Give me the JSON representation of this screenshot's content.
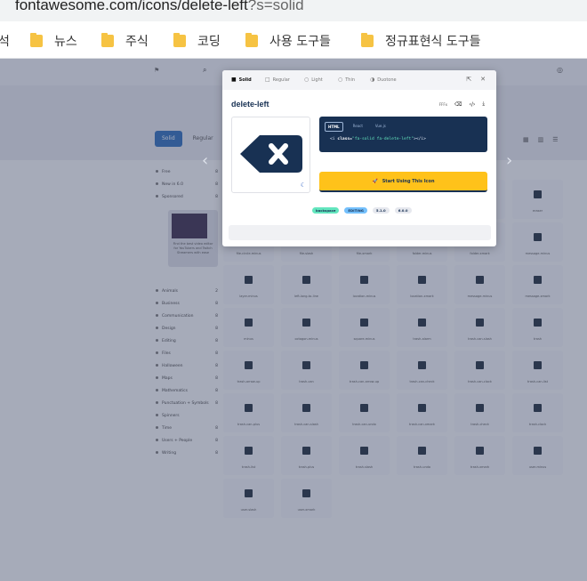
{
  "browser": {
    "url_host_path": "fontawesome.com/icons/delete-left",
    "url_query": "?s=solid"
  },
  "bookmarks": [
    {
      "label": "석",
      "folder": false
    },
    {
      "label": "뉴스",
      "folder": true
    },
    {
      "label": "주식",
      "folder": true
    },
    {
      "label": "코딩",
      "folder": true
    },
    {
      "label": "사용 도구들",
      "folder": true
    },
    {
      "label": "정규표현식 도구들",
      "folder": true
    }
  ],
  "page": {
    "tabs": [
      "Solid",
      "Regular"
    ],
    "sidebar_items": [
      {
        "label": "Free",
        "count": "8"
      },
      {
        "label": "New in 6.0",
        "count": "8"
      },
      {
        "label": "Sponsored",
        "count": "8"
      },
      {
        "label": "Animals",
        "count": "2"
      },
      {
        "label": "Business",
        "count": "8"
      },
      {
        "label": "Communication",
        "count": "8"
      },
      {
        "label": "Design",
        "count": "8"
      },
      {
        "label": "Editing",
        "count": "8"
      },
      {
        "label": "Files",
        "count": "8"
      },
      {
        "label": "Halloween",
        "count": "8"
      },
      {
        "label": "Maps",
        "count": "8"
      },
      {
        "label": "Mathematics",
        "count": "8"
      },
      {
        "label": "Punctuation + Symbols",
        "count": "8"
      },
      {
        "label": "Spinners",
        "count": ""
      },
      {
        "label": "Time",
        "count": "8"
      },
      {
        "label": "Users + People",
        "count": "8"
      },
      {
        "label": "Writing",
        "count": "8"
      }
    ],
    "promo_text": "Find the best video editor for YouTubers and Twitch Streamers with ease",
    "grid_labels": [
      "calendar-xmark",
      "circle-minus",
      "circle-xmark",
      "comment-slash",
      "comment-xmark",
      "eraser",
      "file-circle-minus",
      "file-slash",
      "file-xmark",
      "folder-minus",
      "folder-xmark",
      "message-minus",
      "layer-minus",
      "left-long-to-line",
      "location-minus",
      "location-xmark",
      "message-minus",
      "message-xmark",
      "minus",
      "octagon-minus",
      "square-minus",
      "trash-alarm",
      "trash-can-slash",
      "trash",
      "trash-arrow-up",
      "trash-can",
      "trash-can-arrow-up",
      "trash-can-check",
      "trash-can-clock",
      "trash-can-list",
      "trash-can-plus",
      "trash-can-slash",
      "trash-can-undo",
      "trash-can-xmark",
      "trash-check",
      "trash-clock",
      "trash-list",
      "trash-plus",
      "trash-slash",
      "trash-undo",
      "trash-xmark",
      "user-minus",
      "user-slash",
      "user-xmark"
    ]
  },
  "modal": {
    "style_tabs": [
      {
        "label": "Solid",
        "icon": "■"
      },
      {
        "label": "Regular",
        "icon": "□"
      },
      {
        "label": "Light",
        "icon": "○"
      },
      {
        "label": "Thin",
        "icon": "○"
      },
      {
        "label": "Duotone",
        "icon": "◑"
      }
    ],
    "icon_name": "delete-left",
    "tools_label": "FFFx",
    "code_tabs": [
      "HTML",
      "React",
      "Vue.js"
    ],
    "code": {
      "open": "<i ",
      "attr": "class=",
      "value": "\"fa-solid fa-delete-left\"",
      "close": "></i>"
    },
    "start_button": "Start Using This Icon",
    "tags": [
      {
        "label": "backspace",
        "bg": "#63e6be"
      },
      {
        "label": "EDITING",
        "bg": "#74c0fc"
      },
      {
        "label": "5.1.0",
        "bg": "#e6e8ee"
      },
      {
        "label": "6.0.0",
        "bg": "#e6e8ee"
      }
    ]
  },
  "colors": {
    "brand_navy": "#183153",
    "accent_yellow": "#ffc21a",
    "active_tab_blue": "#2d6cb8"
  }
}
